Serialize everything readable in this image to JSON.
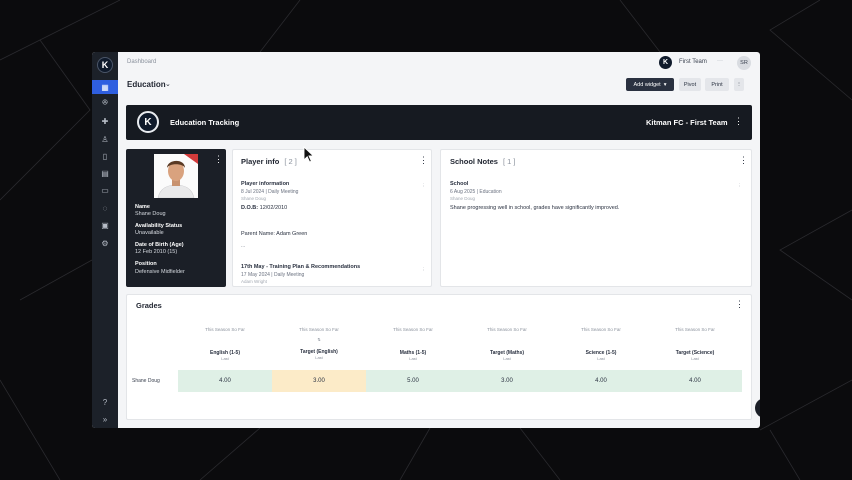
{
  "sidebar": {
    "logo_letter": "K",
    "items": [
      {
        "icon": "bar-chart-icon",
        "glyph": "▦",
        "active": true
      },
      {
        "icon": "users-icon",
        "glyph": "ꔮ"
      },
      {
        "icon": "medical-cross-icon",
        "glyph": "✚"
      },
      {
        "icon": "athlete-icon",
        "glyph": "♙"
      },
      {
        "icon": "clipboard-icon",
        "glyph": "▯"
      },
      {
        "icon": "calendar-icon",
        "glyph": "▤"
      },
      {
        "icon": "bus-icon",
        "glyph": "▭"
      },
      {
        "icon": "chat-icon",
        "glyph": "◌"
      },
      {
        "icon": "document-icon",
        "glyph": "▣"
      },
      {
        "icon": "settings-icon",
        "glyph": "⚙"
      },
      {
        "icon": "help-icon",
        "glyph": "?"
      },
      {
        "icon": "expand-icon",
        "glyph": "»"
      }
    ]
  },
  "topbar": {
    "breadcrumb": "Dashboard",
    "team_name": "First Team",
    "team_dash": "···",
    "user_initials": "SR"
  },
  "header": {
    "page_title": "Education",
    "chevron": "⌄",
    "add_widget_label": "Add widget",
    "add_widget_chevron": "▾",
    "pivot_label": "Pivot",
    "print_label": "Print",
    "more_label": "⋮"
  },
  "banner": {
    "logo_letter": "K",
    "title": "Education Tracking",
    "team": "Kitman FC - First Team",
    "kebab": "⋮"
  },
  "profile": {
    "kebab": "⋮",
    "name_label": "Name",
    "name": "Shane Doug",
    "availability_label": "Availability Status",
    "availability": "Unavailable",
    "dob_label": "Date of Birth (Age)",
    "dob": "12 Feb 2010 (15)",
    "position_label": "Position",
    "position": "Defensive Midfielder"
  },
  "player_info": {
    "title": "Player info",
    "count": "[ 2 ]",
    "kebab": "⋮",
    "entries": [
      {
        "title": "Player information",
        "meta": "8 Jul 2024 | Daily Meeting",
        "author": "Shane Doug",
        "body_label": "D.O.B:",
        "body_value": "12/02/2010",
        "parent": "Parent Name: Adam Green",
        "dots": "..."
      },
      {
        "title": "17th May - Training Plan & Recommendations",
        "meta": "17 May 2024 | Daily Meeting",
        "author": "Adam Wright"
      }
    ],
    "item_kebab": "⋮"
  },
  "school_notes": {
    "title": "School Notes",
    "count": "[ 1 ]",
    "kebab": "⋮",
    "entry": {
      "title": "School",
      "meta": "6 Aug 2025 | Education",
      "author": "Shane Doug",
      "body": "Shane progressing well in school, grades have significantly improved."
    },
    "item_kebab": "⋮"
  },
  "grades": {
    "title": "Grades",
    "kebab": "⋮",
    "row_label": "Shane Doug",
    "sort_icon": "⇅",
    "columns": [
      {
        "season": "This Season So Far",
        "header": "English (1-5)",
        "sub": "Last",
        "value": "4.00",
        "color": "#dff0e6"
      },
      {
        "season": "This Season So Far",
        "header": "Target (English)",
        "sub": "Last",
        "value": "3.00",
        "color": "#fcebc8"
      },
      {
        "season": "This Season So Far",
        "header": "Maths (1-5)",
        "sub": "Last",
        "value": "5.00",
        "color": "#dff0e6"
      },
      {
        "season": "This Season So Far",
        "header": "Target (Maths)",
        "sub": "Last",
        "value": "3.00",
        "color": "#dff0e6"
      },
      {
        "season": "This Season So Far",
        "header": "Science (1-5)",
        "sub": "Last",
        "value": "4.00",
        "color": "#dff0e6"
      },
      {
        "season": "This Season So Far",
        "header": "Target (Science)",
        "sub": "Last",
        "value": "4.00",
        "color": "#dff0e6"
      }
    ]
  }
}
